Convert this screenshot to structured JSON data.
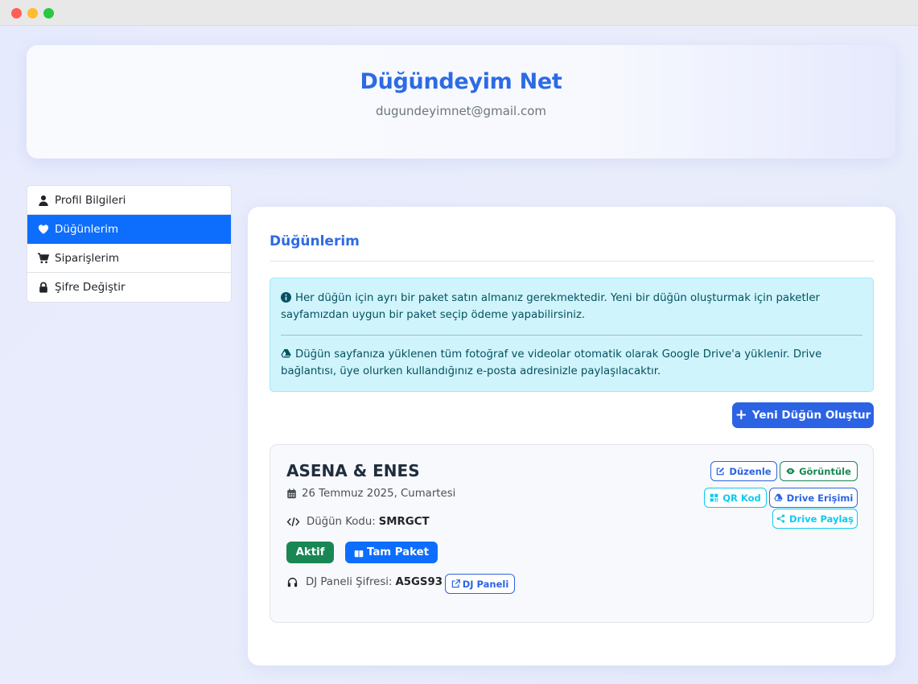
{
  "header": {
    "title": "Düğündeyim Net",
    "email": "dugundeyimnet@gmail.com"
  },
  "sidebar": {
    "items": [
      {
        "label": "Profil Bilgileri",
        "icon": "user-icon",
        "active": false
      },
      {
        "label": "Düğünlerim",
        "icon": "heart-icon",
        "active": true
      },
      {
        "label": "Siparişlerim",
        "icon": "cart-icon",
        "active": false
      },
      {
        "label": "Şifre Değiştir",
        "icon": "lock-icon",
        "active": false
      }
    ]
  },
  "main": {
    "section_title": "Düğünlerim",
    "info_alert": {
      "text1": "Her düğün için ayrı bir paket satın almanız gerekmektedir. Yeni bir düğün oluşturmak için paketler sayfamızdan uygun bir paket seçip ödeme yapabilirsiniz.",
      "text2": "Düğün sayfanıza yüklenen tüm fotoğraf ve videolar otomatik olarak Google Drive'a yüklenir. Drive bağlantısı, üye olurken kullandığınız e-posta adresinizle paylaşılacaktır."
    },
    "new_wedding_button": "Yeni Düğün Oluştur",
    "wedding": {
      "name": "ASENA & ENES",
      "date": "26 Temmuz 2025, Cumartesi",
      "code_label": "Düğün Kodu:",
      "code_value": "SMRGCT",
      "status_badge": "Aktif",
      "package_badge": "Tam Paket",
      "dj_label": "DJ Paneli Şifresi:",
      "dj_password": "A5GS93",
      "buttons": {
        "edit": "Düzenle",
        "view": "Görüntüle",
        "qr": "QR Kod",
        "drive_access": "Drive Erişimi",
        "drive_share": "Drive Paylaş",
        "dj_panel": "DJ Paneli"
      }
    }
  },
  "colors": {
    "brand": "#2c6be4",
    "active": "#0d6efd",
    "success": "#198754",
    "info_bg": "#cff4fc",
    "info_text": "#055160",
    "cyan": "#0dcaf0"
  }
}
